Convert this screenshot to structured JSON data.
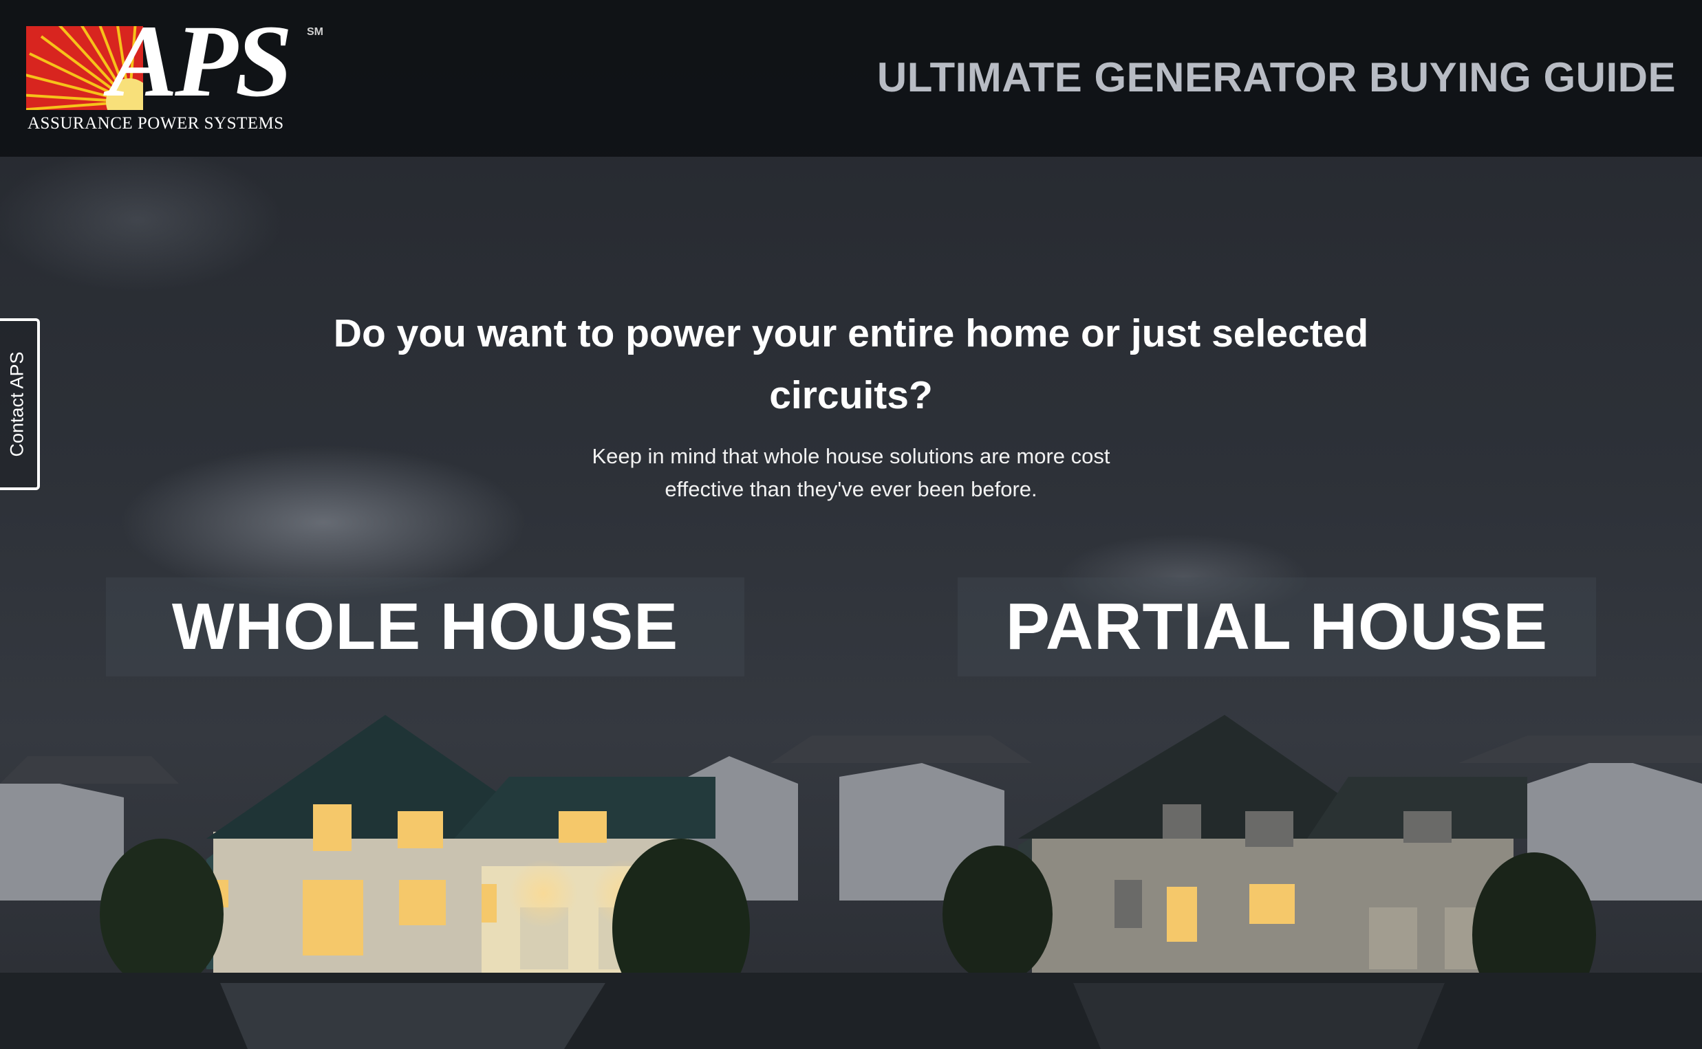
{
  "header": {
    "logo_text": "APS",
    "logo_sm": "SM",
    "logo_subtitle": "ASSURANCE POWER SYSTEMS",
    "guide_title": "ULTIMATE GENERATOR BUYING GUIDE"
  },
  "contact_tab": {
    "label": "Contact APS"
  },
  "main": {
    "question": "Do you want to power your entire home or just selected circuits?",
    "subtext": "Keep in mind that whole house solutions are more cost effective than they've ever been before.",
    "options": [
      {
        "label": "WHOLE HOUSE"
      },
      {
        "label": "PARTIAL HOUSE"
      }
    ]
  },
  "colors": {
    "logo_red": "#d8251f",
    "logo_sun": "#f6c21a",
    "header_bg": "#0e1013",
    "title_gray": "#b8bcc4",
    "window_light": "#f5c86a"
  },
  "icons": [
    "sun-burst-logo-icon"
  ]
}
